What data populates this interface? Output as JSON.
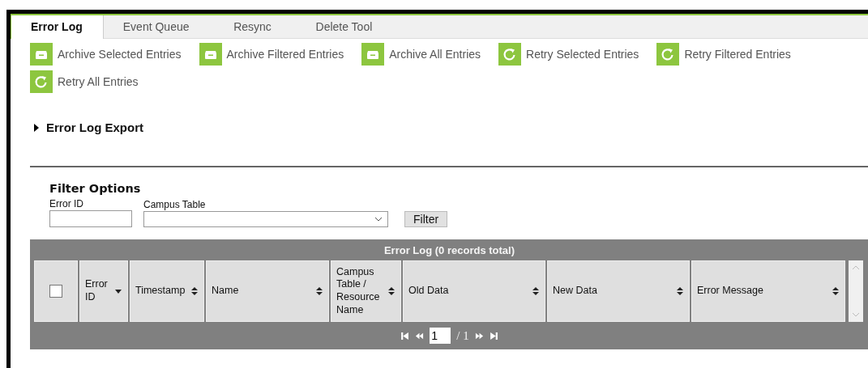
{
  "tabs": [
    {
      "label": "Error Log",
      "selected": true
    },
    {
      "label": "Event Queue",
      "selected": false
    },
    {
      "label": "Resync",
      "selected": false
    },
    {
      "label": "Delete Tool",
      "selected": false
    }
  ],
  "actions": [
    {
      "label": "Archive Selected Entries",
      "kind": "archive"
    },
    {
      "label": "Archive Filtered Entries",
      "kind": "archive"
    },
    {
      "label": "Archive All Entries",
      "kind": "archive"
    },
    {
      "label": "Retry Selected Entries",
      "kind": "retry"
    },
    {
      "label": "Retry Filtered Entries",
      "kind": "retry"
    },
    {
      "label": "Retry All Entries",
      "kind": "retry"
    }
  ],
  "export": {
    "label": "Error Log Export",
    "expanded": false
  },
  "filter": {
    "title": "Filter Options",
    "error_id_label": "Error ID",
    "campus_table_label": "Campus Table",
    "button": "Filter"
  },
  "grid": {
    "title": "Error Log (0 records total)",
    "select_all_checked": false,
    "columns": [
      {
        "label": "Error ID",
        "sorted": true
      },
      {
        "label": "Timestamp",
        "sorted": false
      },
      {
        "label": "Name",
        "sorted": false
      },
      {
        "label": "Campus Table / Resource Name",
        "sorted": false
      },
      {
        "label": "Old Data",
        "sorted": false
      },
      {
        "label": "New Data",
        "sorted": false
      },
      {
        "label": "Error Message",
        "sorted": false
      }
    ],
    "pager": {
      "page": "1",
      "total": "/ 1"
    }
  }
}
